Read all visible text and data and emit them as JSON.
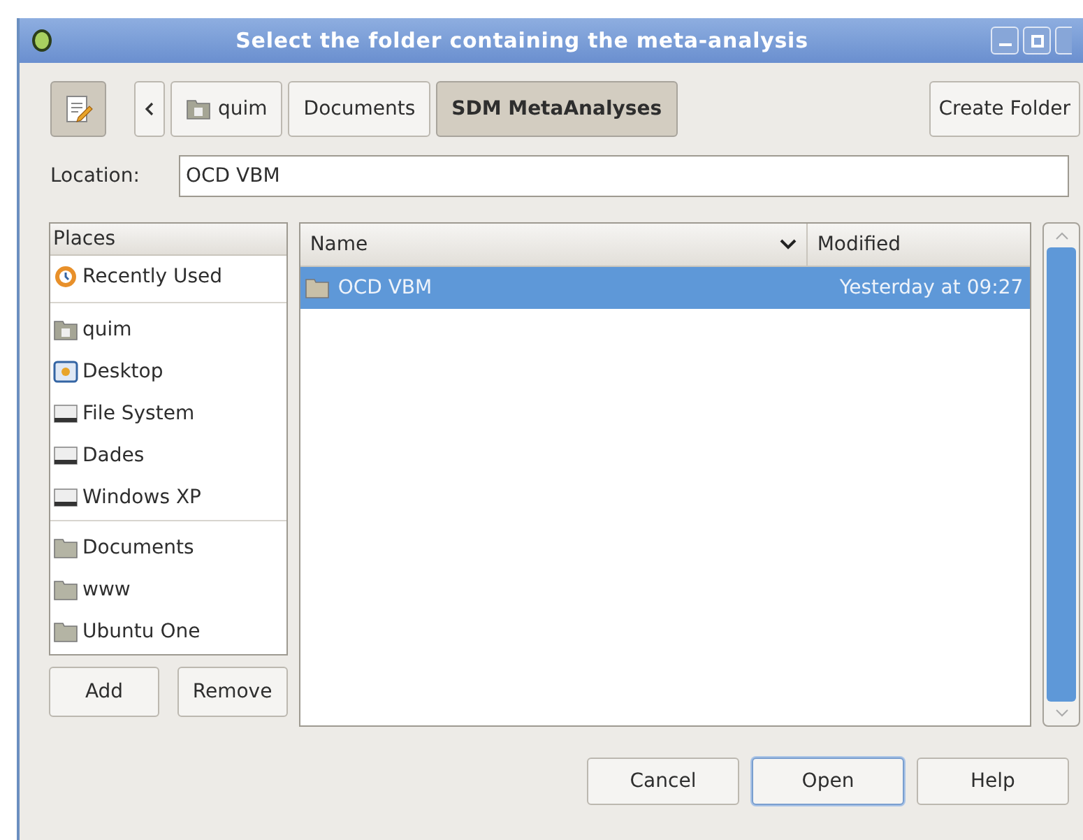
{
  "window": {
    "title": "Select the folder containing the meta-analysis"
  },
  "path_bar": {
    "items": [
      {
        "label": "quim",
        "kind": "home",
        "selected": false
      },
      {
        "label": "Documents",
        "kind": "plain",
        "selected": false
      },
      {
        "label": "SDM MetaAnalyses",
        "kind": "plain",
        "selected": true
      }
    ],
    "create_folder": "Create Folder"
  },
  "location": {
    "label": "Location:",
    "value": "OCD VBM"
  },
  "places": {
    "header": "Places",
    "groups": [
      [
        {
          "label": "Recently Used",
          "kind": "recent"
        }
      ],
      [
        {
          "label": "quim",
          "kind": "home"
        },
        {
          "label": "Desktop",
          "kind": "desktop"
        },
        {
          "label": "File System",
          "kind": "drive"
        },
        {
          "label": "Dades",
          "kind": "drive"
        },
        {
          "label": "Windows XP",
          "kind": "drive"
        }
      ],
      [
        {
          "label": "Documents",
          "kind": "folder"
        },
        {
          "label": "www",
          "kind": "folder"
        },
        {
          "label": "Ubuntu One",
          "kind": "folder"
        }
      ]
    ],
    "buttons": [
      "Add",
      "Remove"
    ]
  },
  "files": {
    "columns": [
      "Name",
      "Modified"
    ],
    "rows": [
      {
        "name": "OCD VBM",
        "modified": "Yesterday at 09:27",
        "selected": true
      }
    ]
  },
  "buttons": [
    {
      "label": "Cancel",
      "default": false
    },
    {
      "label": "Open",
      "default": true
    },
    {
      "label": "Help",
      "default": false
    }
  ]
}
